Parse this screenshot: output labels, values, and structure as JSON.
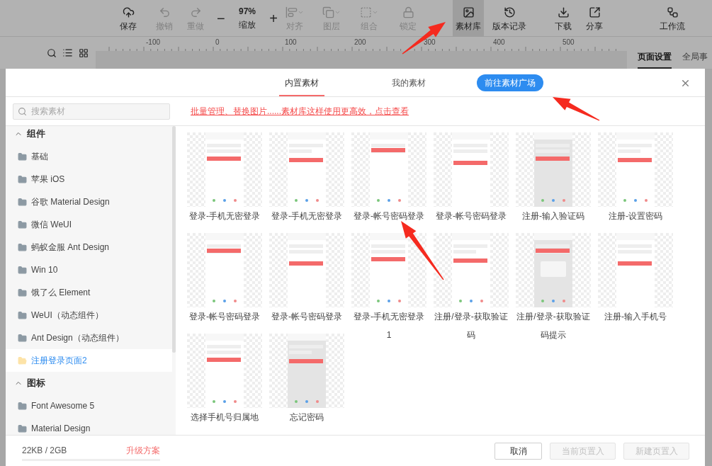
{
  "toolbar": {
    "items": [
      {
        "kind": "button",
        "label": "保存",
        "disabled": false,
        "selected": false
      },
      {
        "kind": "button",
        "label": "撤销",
        "disabled": true,
        "selected": false
      },
      {
        "kind": "button",
        "label": "重做",
        "disabled": true,
        "selected": false
      },
      {
        "kind": "zoom",
        "minus": "−",
        "value": "97%",
        "label": "缩放",
        "plus": "+"
      },
      {
        "kind": "button",
        "label": "对齐",
        "disabled": true,
        "selected": false
      },
      {
        "kind": "button",
        "label": "图层",
        "disabled": true,
        "selected": false
      },
      {
        "kind": "button",
        "label": "组合",
        "disabled": true,
        "selected": false
      },
      {
        "kind": "button",
        "label": "锁定",
        "disabled": true,
        "selected": false
      },
      {
        "kind": "button",
        "label": "素材库",
        "disabled": false,
        "selected": true
      },
      {
        "kind": "button",
        "label": "版本记录",
        "disabled": false,
        "selected": false
      },
      {
        "kind": "button",
        "label": "下载",
        "disabled": false,
        "selected": false
      },
      {
        "kind": "button",
        "label": "分享",
        "disabled": false,
        "selected": false
      },
      {
        "kind": "button",
        "label": "工作流",
        "disabled": false,
        "selected": false
      }
    ]
  },
  "ruler": {
    "labels": [
      "-100",
      "0",
      "100",
      "200",
      "300",
      "400",
      "500"
    ]
  },
  "right_panel": {
    "tabs": [
      {
        "label": "页面设置",
        "selected": true
      },
      {
        "label": "全局事",
        "selected": false
      }
    ]
  },
  "dialog": {
    "tabs": [
      {
        "label": "内置素材",
        "selected": true
      },
      {
        "label": "我的素材",
        "selected": false
      }
    ],
    "market_button": "前往素材广场",
    "search": {
      "placeholder": "搜索素材"
    },
    "tip_link": "批量管理、替换图片......素材库这样使用更高效，点击查看",
    "sidebar": {
      "sections": [
        {
          "title": "组件",
          "expanded": true,
          "items": [
            {
              "label": "基础",
              "selected": false
            },
            {
              "label": "苹果 iOS",
              "selected": false
            },
            {
              "label": "谷歌 Material Design",
              "selected": false
            },
            {
              "label": "微信 WeUI",
              "selected": false
            },
            {
              "label": "蚂蚁金服 Ant Design",
              "selected": false
            },
            {
              "label": "Win 10",
              "selected": false
            },
            {
              "label": "饿了么 Element",
              "selected": false
            },
            {
              "label": "WeUI（动态组件）",
              "selected": false
            },
            {
              "label": "Ant Design（动态组件）",
              "selected": false
            },
            {
              "label": "注册登录页面2",
              "selected": true
            }
          ]
        },
        {
          "title": "图标",
          "expanded": true,
          "items": [
            {
              "label": "Font Awesome 5",
              "selected": false
            },
            {
              "label": "Material Design",
              "selected": false
            }
          ]
        }
      ]
    },
    "assets": [
      {
        "lines": [
          "登录-手机无密登录"
        ]
      },
      {
        "lines": [
          "登录-手机无密登录"
        ]
      },
      {
        "lines": [
          "登录-帐号密码登录"
        ]
      },
      {
        "lines": [
          "登录-帐号密码登录"
        ]
      },
      {
        "lines": [
          "注册-输入验证码"
        ]
      },
      {
        "lines": [
          "注册-设置密码"
        ]
      },
      {
        "lines": [
          "登录-帐号密码登录"
        ]
      },
      {
        "lines": [
          "登录-帐号密码登录"
        ]
      },
      {
        "lines": [
          "登录-手机无密登录",
          "1"
        ]
      },
      {
        "lines": [
          "注册/登录-获取验证",
          "码"
        ]
      },
      {
        "lines": [
          "注册/登录-获取验证",
          "码提示"
        ]
      },
      {
        "lines": [
          "注册-输入手机号"
        ]
      },
      {
        "lines": [
          "选择手机号归属地"
        ]
      },
      {
        "lines": [
          "忘记密码"
        ]
      }
    ],
    "footer": {
      "storage": {
        "text": "22KB / 2GB",
        "level": 0
      },
      "upgrade": "升级方案",
      "buttons": [
        {
          "label": "取消",
          "disabled": false
        },
        {
          "label": "当前页置入",
          "disabled": true
        },
        {
          "label": "新建页置入",
          "disabled": true
        }
      ]
    }
  }
}
